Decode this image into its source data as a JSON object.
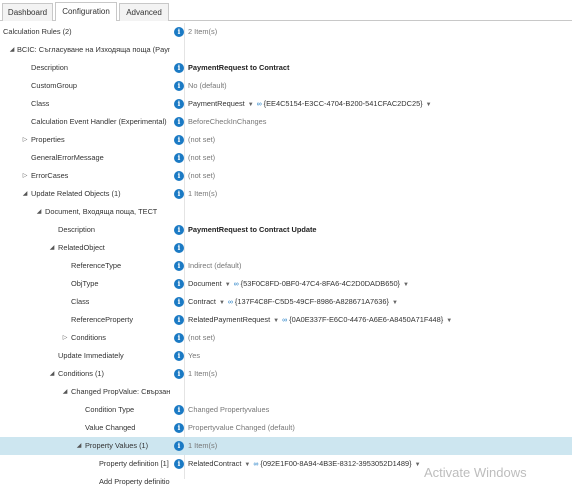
{
  "tabs": [
    "Dashboard",
    "Configuration",
    "Advanced"
  ],
  "rows": [
    {
      "label": "Calculation Rules (2)",
      "value": "2 Item(s)"
    },
    {
      "label": "BCIC: Съгласуване на Изходяща поща (Paymen...",
      "value": ""
    },
    {
      "label": "Description",
      "value": "PaymentRequest to Contract"
    },
    {
      "label": "CustomGroup",
      "value": "No (default)"
    },
    {
      "label": "Class",
      "value": "PaymentRequest",
      "guid": "{EE4C5154-E3CC-4704-B200-541CFAC2DC25}"
    },
    {
      "label": "Calculation Event Handler (Experimental)",
      "value": "BeforeCheckInChanges"
    },
    {
      "label": "Properties",
      "value": "(not set)"
    },
    {
      "label": "GeneralErrorMessage",
      "value": "(not set)"
    },
    {
      "label": "ErrorCases",
      "value": "(not set)"
    },
    {
      "label": "Update Related Objects (1)",
      "value": "1 Item(s)"
    },
    {
      "label": "Document, Входяща поща, ТЕСТ",
      "value": ""
    },
    {
      "label": "Description",
      "value": "PaymentRequest to Contract Update"
    },
    {
      "label": "RelatedObject",
      "value": ""
    },
    {
      "label": "ReferenceType",
      "value": "Indirect (default)"
    },
    {
      "label": "ObjType",
      "value": "Document",
      "guid": "{53F0C8FD-0BF0-47C4-8FA6-4C2D0DADB650}"
    },
    {
      "label": "Class",
      "value": "Contract",
      "guid": "{137F4C8F-C5D5-49CF-8986-A828671A7636}"
    },
    {
      "label": "ReferenceProperty",
      "value": "RelatedPaymentRequest",
      "guid": "{0A0E337F-E6C0-4476-A6E6-A8450A71F448}"
    },
    {
      "label": "Conditions",
      "value": "(not set)"
    },
    {
      "label": "Update Immediately",
      "value": "Yes"
    },
    {
      "label": "Conditions (1)",
      "value": "1 Item(s)"
    },
    {
      "label": "Changed PropValue: Свързан с...",
      "value": ""
    },
    {
      "label": "Condition Type",
      "value": "Changed Propertyvalues"
    },
    {
      "label": "Value Changed",
      "value": "Propertyvalue Changed (default)"
    },
    {
      "label": "Property Values (1)",
      "value": "1 Item(s)"
    },
    {
      "label": "Property definition [1]",
      "value": "RelatedContract",
      "guid": "{092E1F00-8A94-4B3E-8312-3953052D1489}"
    },
    {
      "label": "Add Property definition",
      "value": ""
    }
  ],
  "watermark": "Activate Windows",
  "colors": {
    "info_icon": "#1b7ac4",
    "selected_row": "#cde6f0"
  },
  "icons": {
    "info": "info-icon",
    "expand": "triangle-icon",
    "dropdown": "dropdown-icon",
    "link": "link-icon"
  }
}
